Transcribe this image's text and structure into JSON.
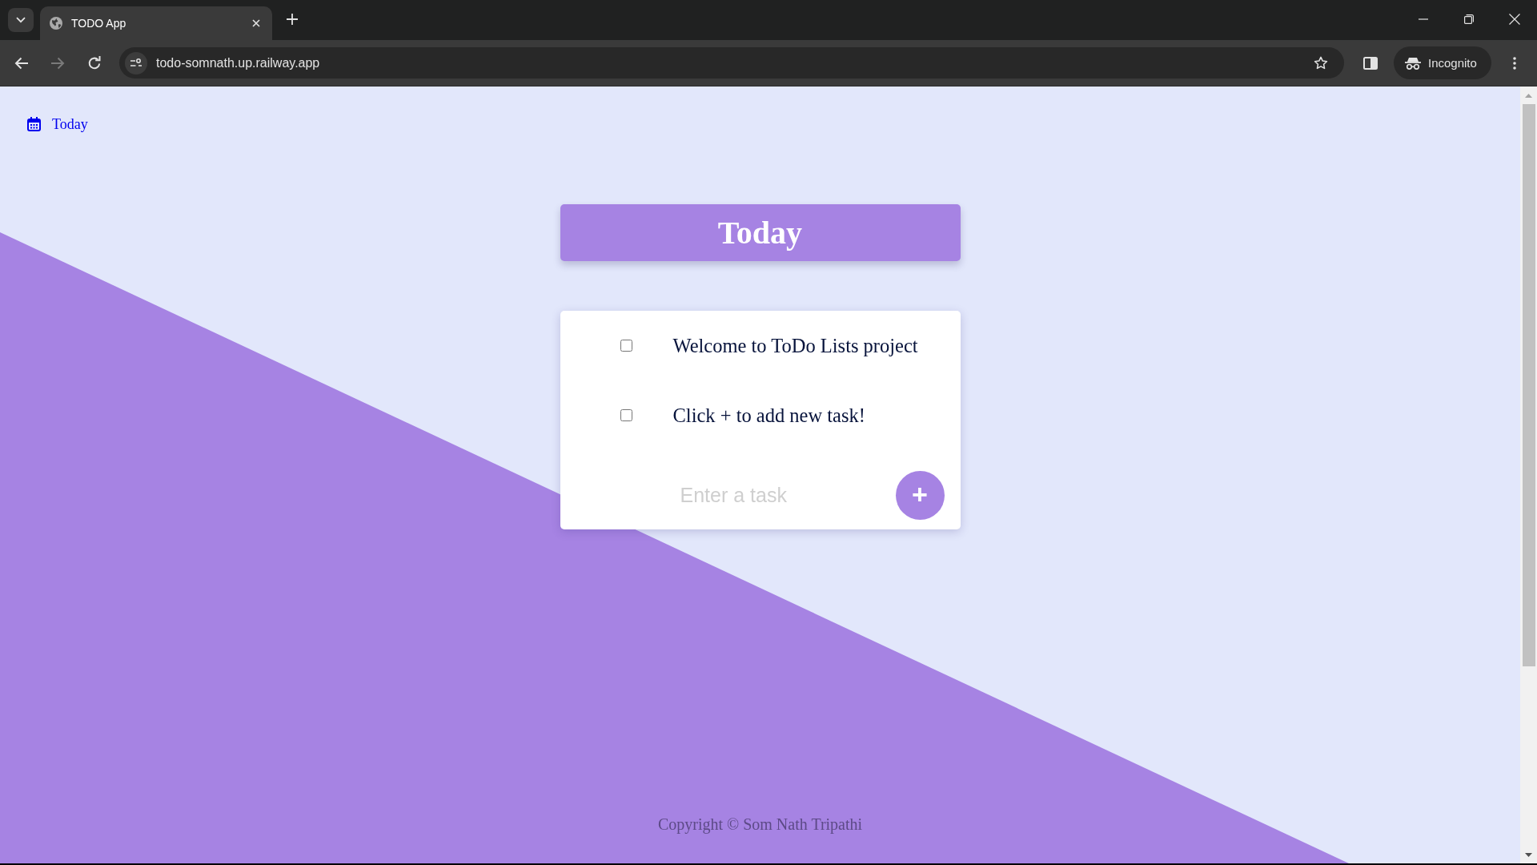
{
  "browser": {
    "tabs": [
      {
        "title": "TODO App",
        "selected": true
      }
    ],
    "address_bar": {
      "url": "todo-somnath.up.railway.app"
    },
    "profile_chip": {
      "label": "Incognito"
    }
  },
  "nav": {
    "link": "Today"
  },
  "heading": "Today",
  "tasks": [
    {
      "text": "Welcome to ToDo Lists project",
      "checked": false
    },
    {
      "text": "Click + to add new task!",
      "checked": false
    }
  ],
  "new_task": {
    "placeholder": "Enter a task",
    "button": "+"
  },
  "footer": "Copyright © Som Nath Tripathi"
}
